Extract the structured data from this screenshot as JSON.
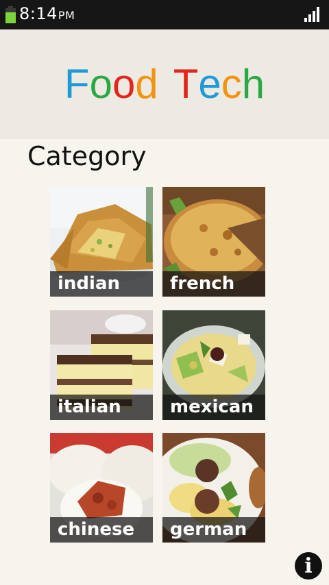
{
  "status_bar": {
    "time": "8:14",
    "ampm": "PM",
    "battery_color": "#7ed43b"
  },
  "app": {
    "title_letters": [
      {
        "ch": "F",
        "color": "#1e9ad6"
      },
      {
        "ch": "o",
        "color": "#2aa844"
      },
      {
        "ch": "o",
        "color": "#e2261c"
      },
      {
        "ch": "d",
        "color": "#f29410"
      },
      {
        "ch": " ",
        "color": "#000000"
      },
      {
        "ch": "T",
        "color": "#e2261c"
      },
      {
        "ch": "e",
        "color": "#1e9ad6"
      },
      {
        "ch": "c",
        "color": "#f29410"
      },
      {
        "ch": "h",
        "color": "#2aa844"
      }
    ]
  },
  "main": {
    "section_title": "Category",
    "categories": [
      {
        "label": "indian"
      },
      {
        "label": "french"
      },
      {
        "label": "italian"
      },
      {
        "label": "mexican"
      },
      {
        "label": "chinese"
      },
      {
        "label": "german"
      }
    ]
  },
  "footer": {
    "info_glyph": "i",
    "icon": "info-icon"
  }
}
